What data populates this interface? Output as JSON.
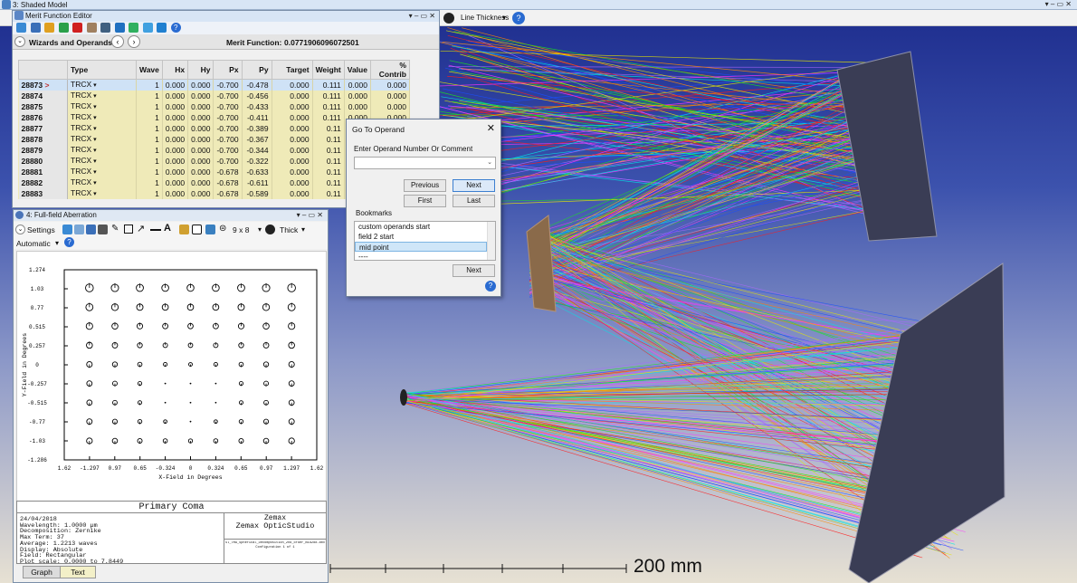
{
  "shaded": {
    "title": "3: Shaded Model",
    "line_thickness_label": "Line Thickness",
    "scale_label": "200 mm"
  },
  "mfe": {
    "title": "Merit Function Editor",
    "wizards_label": "Wizards and Operands",
    "merit_label": "Merit Function:",
    "merit_value": "0.0771906096072501",
    "columns": [
      "Type",
      "Wave",
      "Hx",
      "Hy",
      "Px",
      "Py",
      "Target",
      "Weight",
      "Value",
      "% Contrib"
    ],
    "rows": [
      {
        "num": "28873",
        "type": "TRCX",
        "wave": "1",
        "hx": "0.000",
        "hy": "0.000",
        "px": "-0.700",
        "py": "-0.478",
        "target": "0.000",
        "weight": "0.111",
        "value": "0.000",
        "contrib": "0.000"
      },
      {
        "num": "28874",
        "type": "TRCX",
        "wave": "1",
        "hx": "0.000",
        "hy": "0.000",
        "px": "-0.700",
        "py": "-0.456",
        "target": "0.000",
        "weight": "0.111",
        "value": "0.000",
        "contrib": "0.000"
      },
      {
        "num": "28875",
        "type": "TRCX",
        "wave": "1",
        "hx": "0.000",
        "hy": "0.000",
        "px": "-0.700",
        "py": "-0.433",
        "target": "0.000",
        "weight": "0.111",
        "value": "0.000",
        "contrib": "0.000"
      },
      {
        "num": "28876",
        "type": "TRCX",
        "wave": "1",
        "hx": "0.000",
        "hy": "0.000",
        "px": "-0.700",
        "py": "-0.411",
        "target": "0.000",
        "weight": "0.111",
        "value": "0.000",
        "contrib": "0.000"
      },
      {
        "num": "28877",
        "type": "TRCX",
        "wave": "1",
        "hx": "0.000",
        "hy": "0.000",
        "px": "-0.700",
        "py": "-0.389",
        "target": "0.000",
        "weight": "0.11",
        "value": "",
        "contrib": ""
      },
      {
        "num": "28878",
        "type": "TRCX",
        "wave": "1",
        "hx": "0.000",
        "hy": "0.000",
        "px": "-0.700",
        "py": "-0.367",
        "target": "0.000",
        "weight": "0.11",
        "value": "",
        "contrib": ""
      },
      {
        "num": "28879",
        "type": "TRCX",
        "wave": "1",
        "hx": "0.000",
        "hy": "0.000",
        "px": "-0.700",
        "py": "-0.344",
        "target": "0.000",
        "weight": "0.11",
        "value": "",
        "contrib": ""
      },
      {
        "num": "28880",
        "type": "TRCX",
        "wave": "1",
        "hx": "0.000",
        "hy": "0.000",
        "px": "-0.700",
        "py": "-0.322",
        "target": "0.000",
        "weight": "0.11",
        "value": "",
        "contrib": ""
      },
      {
        "num": "28881",
        "type": "TRCX",
        "wave": "1",
        "hx": "0.000",
        "hy": "0.000",
        "px": "-0.678",
        "py": "-0.633",
        "target": "0.000",
        "weight": "0.11",
        "value": "",
        "contrib": ""
      },
      {
        "num": "28882",
        "type": "TRCX",
        "wave": "1",
        "hx": "0.000",
        "hy": "0.000",
        "px": "-0.678",
        "py": "-0.611",
        "target": "0.000",
        "weight": "0.11",
        "value": "",
        "contrib": ""
      },
      {
        "num": "28883",
        "type": "TRCX",
        "wave": "1",
        "hx": "0.000",
        "hy": "0.000",
        "px": "-0.678",
        "py": "-0.589",
        "target": "0.000",
        "weight": "0.11",
        "value": "",
        "contrib": ""
      }
    ]
  },
  "goto": {
    "title": "Go To Operand",
    "prompt": "Enter Operand Number Or Comment",
    "previous": "Previous",
    "next": "Next",
    "first": "First",
    "last": "Last",
    "bookmarks_label": "Bookmarks",
    "bookmarks": [
      "custom operands start",
      "field 2 start",
      "mid point",
      "----"
    ],
    "selected_bookmark": "mid point",
    "bookmark_next": "Next"
  },
  "ffa": {
    "title": "4: Full-field Aberration",
    "settings": "Settings",
    "grid_label": "9 x 8",
    "thick_label": "Thick",
    "auto_label": "Automatic",
    "plot_title": "Primary Coma",
    "brand1": "Zemax",
    "brand2": "Zemax OpticStudio",
    "stats": [
      "24/04/2018",
      "Wavelength: 1.0000 µm",
      "Decomposition: Zernike",
      "Max Term: 37",
      "Average: 1.2213 waves",
      "Display: Absolute",
      "Field: Rectangular",
      "Plot scale: 0.0000 to 7.8449"
    ],
    "file_line1": "Sl_TMA_Spherical_Decomposition_2nd_order_mid2d8.zmx",
    "file_line2": "Configuration 1 of 1",
    "tab_graph": "Graph",
    "tab_text": "Text"
  },
  "chart_data": {
    "type": "scatter",
    "title": "",
    "xlabel": "X-Field in Degrees",
    "ylabel": "Y-Field in Degrees",
    "x_ticks": [
      "1.62",
      "-1.297",
      "0.97",
      "0.65",
      "-0.324",
      "0",
      "0.324",
      "0.65",
      "0.97",
      "1.297",
      "1.62"
    ],
    "y_ticks": [
      "1.274",
      "1.03",
      "0.77",
      "0.515",
      "0.257",
      "0",
      "-0.257",
      "-0.515",
      "-0.77",
      "-1.03",
      "-1.286"
    ],
    "grid_x": [
      -1.297,
      -0.97,
      -0.65,
      -0.324,
      0,
      0.324,
      0.65,
      0.97,
      1.297
    ],
    "grid_y": [
      1.03,
      0.77,
      0.515,
      0.257,
      0,
      -0.257,
      -0.515,
      -0.77,
      -1.03
    ],
    "xlim": [
      -1.62,
      1.62
    ],
    "ylim": [
      -1.286,
      1.274
    ],
    "note": "Symbol size shows primary coma magnitude at each field point"
  }
}
